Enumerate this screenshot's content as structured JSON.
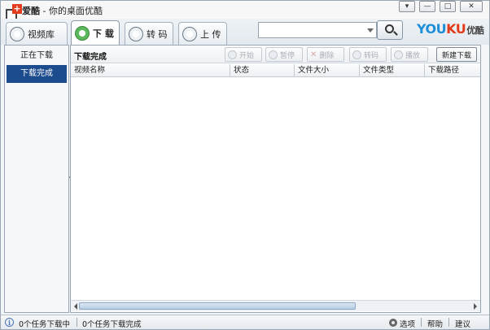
{
  "window": {
    "app_name": "爱酷",
    "title_separator": "-",
    "title_suffix": "你的桌面优酷",
    "controls": {
      "dropdown": "▾",
      "minimize": "—",
      "maximize": "□",
      "close": "✕"
    }
  },
  "tabs": [
    {
      "label": "视频库",
      "icon": "house-icon"
    },
    {
      "label": "下 载",
      "icon": "download-icon"
    },
    {
      "label": "转 码",
      "icon": "convert-icon"
    },
    {
      "label": "上 传",
      "icon": "upload-icon"
    }
  ],
  "search": {
    "value": "",
    "placeholder": ""
  },
  "brand": {
    "part1": "YOU",
    "part2": "KU",
    "cn": "优酷"
  },
  "sidebar": {
    "items": [
      {
        "label": "正在下载",
        "selected": false
      },
      {
        "label": "下载完成",
        "selected": true
      }
    ]
  },
  "main": {
    "section_title": "下载完成",
    "toolbar": {
      "start": "开始",
      "pause": "暂停",
      "delete": "删除",
      "transcode": "转码",
      "play": "播放",
      "new_download": "新建下载"
    },
    "columns": [
      "视频名称",
      "状态",
      "文件大小",
      "文件类型",
      "下载路径"
    ],
    "rows": []
  },
  "status": {
    "info_icon": "i",
    "downloading": "0个任务下载中",
    "completed": "0个任务下载完成",
    "options": "选项",
    "help": "帮助",
    "feedback": "建议"
  },
  "colors": {
    "brand_blue": "#1f8fd8",
    "brand_red": "#e23b1e",
    "selected_nav": "#1c4b8e",
    "active_tab_icon": "#5cb85c"
  }
}
